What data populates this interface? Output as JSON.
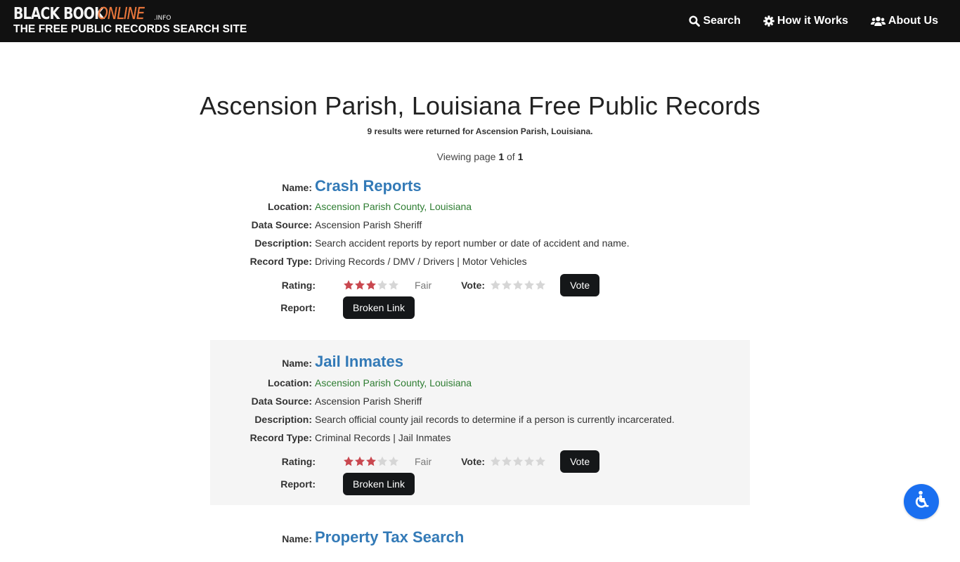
{
  "header": {
    "brand_black": "BLACK BOOK",
    "brand_online": "ONLINE",
    "brand_suffix": ".INFO",
    "tagline": "THE FREE PUBLIC RECORDS SEARCH SITE",
    "nav": [
      {
        "label": "Search",
        "icon": "search-icon"
      },
      {
        "label": "How it Works",
        "icon": "gear-icon"
      },
      {
        "label": "About Us",
        "icon": "users-icon"
      }
    ]
  },
  "page": {
    "title": "Ascension Parish, Louisiana Free Public Records",
    "result_count": "9 results were returned for Ascension Parish, Louisiana.",
    "paging_prefix": "Viewing page",
    "current_page": "1",
    "paging_of": "of",
    "total_pages": "1"
  },
  "labels": {
    "name": "Name:",
    "location": "Location:",
    "data_source": "Data Source:",
    "description": "Description:",
    "record_type": "Record Type:",
    "rating": "Rating:",
    "vote": "Vote:",
    "report": "Report:",
    "vote_button": "Vote",
    "broken_link_button": "Broken Link"
  },
  "colors": {
    "header_bg": "#111111",
    "brand_accent": "#e9773c",
    "link_blue": "#337ab7",
    "location_green": "#2e7d32",
    "star_filled": "#c9474f",
    "star_empty": "#d6d6d6",
    "button_bg": "#151719",
    "alt_card_bg": "#f5f5f5",
    "accessibility_blue": "#1a6ff0"
  },
  "results": [
    {
      "name": "Crash Reports",
      "location": "Ascension Parish County, Louisiana",
      "data_source": "Ascension Parish Sheriff",
      "description": "Search accident reports by report number or date of accident and name.",
      "record_type": "Driving Records / DMV / Drivers | Motor Vehicles",
      "rating_stars": 3,
      "rating_max": 5,
      "rating_text": "Fair",
      "vote_stars": 0
    },
    {
      "name": "Jail Inmates",
      "location": "Ascension Parish County, Louisiana",
      "data_source": "Ascension Parish Sheriff",
      "description": "Search official county jail records to determine if a person is currently incarcerated.",
      "record_type": "Criminal Records | Jail Inmates",
      "rating_stars": 3,
      "rating_max": 5,
      "rating_text": "Fair",
      "vote_stars": 0
    },
    {
      "name": "Property Tax Search"
    }
  ],
  "accessibility": {
    "icon": "wheelchair-icon"
  }
}
